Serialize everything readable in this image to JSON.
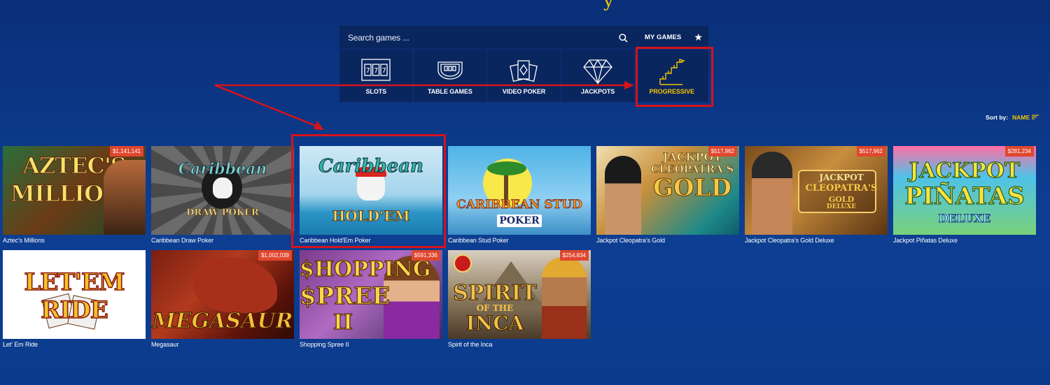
{
  "search": {
    "placeholder": "Search games ..."
  },
  "my_games": {
    "label": "MY GAMES"
  },
  "categories": [
    {
      "label": "SLOTS",
      "icon": "slots-icon"
    },
    {
      "label": "TABLE GAMES",
      "icon": "table-games-icon"
    },
    {
      "label": "VIDEO POKER",
      "icon": "video-poker-icon"
    },
    {
      "label": "JACKPOTS",
      "icon": "jackpots-icon"
    },
    {
      "label": "PROGRESSIVE",
      "icon": "progressive-icon",
      "active": true
    }
  ],
  "sort": {
    "label": "Sort by:",
    "value": "NAME"
  },
  "games": [
    {
      "title": "Aztec's Millions",
      "jackpot": "$1,141,141",
      "art": "AZTEC'S MILLIONS"
    },
    {
      "title": "Caribbean Draw Poker",
      "jackpot": "",
      "art": "Caribbean DRAW POKER"
    },
    {
      "title": "Caribbean Hold'Em Poker",
      "jackpot": "",
      "art": "Caribbean HOLD'EM"
    },
    {
      "title": "Caribbean Stud Poker",
      "jackpot": "",
      "art": "CARIBBEAN STUD POKER"
    },
    {
      "title": "Jackpot Cleopatra's Gold",
      "jackpot": "$517,962",
      "art": "JACKPOT CLEOPATRA'S GOLD"
    },
    {
      "title": "Jackpot Cleopatra's Gold Deluxe",
      "jackpot": "$517,962",
      "art": "JACKPOT CLEOPATRA'S GOLD DELUXE"
    },
    {
      "title": "Jackpot Piñatas Deluxe",
      "jackpot": "$281,234",
      "art": "JACKPOT PIÑATAS DELUXE"
    },
    {
      "title": "Let' Em Ride",
      "jackpot": "",
      "art": "LET'EM RIDE"
    },
    {
      "title": "Megasaur",
      "jackpot": "$1,002,039",
      "art": "MEGASAUR"
    },
    {
      "title": "Shopping Spree II",
      "jackpot": "$591,336",
      "art": "SHOPPING SPREE II"
    },
    {
      "title": "Spirit of the Inca",
      "jackpot": "$254,834",
      "art": "SPIRIT OF THE INCA"
    }
  ],
  "colors": {
    "accent": "#f5c400",
    "highlight": "#d6131b",
    "badge": "#e0472f",
    "panel": "#0a265f"
  }
}
